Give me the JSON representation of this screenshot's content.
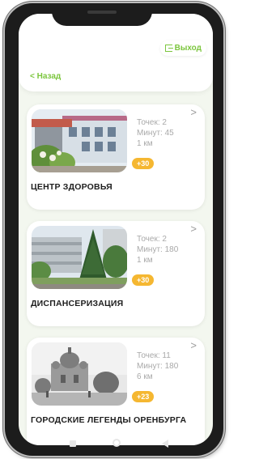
{
  "header": {
    "exit_label": "Выход",
    "back_label": "< Назад"
  },
  "colors": {
    "accent_green": "#7cc63e",
    "badge_orange": "#f5b731"
  },
  "routes": [
    {
      "title": "ЦЕНТР ЗДОРОВЬЯ",
      "points": "Точек: 2",
      "minutes": "Минут: 45",
      "distance": "1 км",
      "bonus": "+30",
      "arrow": ">",
      "image": "health-center-building"
    },
    {
      "title": "ДИСПАНСЕРИЗАЦИЯ",
      "points": "Точек: 2",
      "minutes": "Минут: 180",
      "distance": "1 км",
      "bonus": "+30",
      "arrow": ">",
      "image": "clinic-building-with-trees"
    },
    {
      "title": "ГОРОДСКИЕ ЛЕГЕНДЫ ОРЕНБУРГА",
      "points": "Точек: 11",
      "minutes": "Минут: 180",
      "distance": "6 км",
      "bonus": "+23",
      "arrow": ">",
      "image": "historic-cathedral-photo"
    }
  ]
}
